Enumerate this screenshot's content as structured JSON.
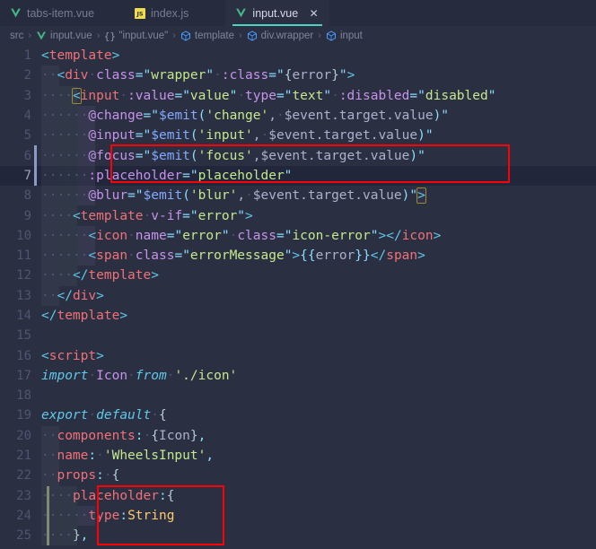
{
  "window": {
    "title": "input.vue"
  },
  "tabs": [
    {
      "label": "tabs-item.vue",
      "icon": "vue-file-icon",
      "active": false,
      "closable": false
    },
    {
      "label": "index.js",
      "icon": "js-file-icon",
      "active": false,
      "closable": false
    },
    {
      "label": "input.vue",
      "icon": "vue-file-icon",
      "active": true,
      "closable": true,
      "close_label": "✕"
    }
  ],
  "breadcrumb": {
    "separator": "›",
    "items": [
      {
        "label": "src",
        "icon": "none"
      },
      {
        "label": "input.vue",
        "icon": "vue-file-icon"
      },
      {
        "label": "\"input.vue\"",
        "icon": "braces-icon"
      },
      {
        "label": "template",
        "icon": "element-icon"
      },
      {
        "label": "div.wrapper",
        "icon": "element-icon"
      },
      {
        "label": "input",
        "icon": "element-icon"
      }
    ]
  },
  "colors": {
    "editor_background": "#2b2f42",
    "tabbar_background": "#262b3d",
    "active_tab_underline": "#4fd2c2",
    "annotation_red": "#fb0007",
    "git_added_marker": "#7d8f6b",
    "active_line_background": "#22263a",
    "tag_color": "#f07178",
    "attribute_color": "#c792ea",
    "string_color": "#c3e88d",
    "keyword_color": "#5fc8e8",
    "type_color": "#ffcb6b"
  },
  "editor": {
    "active_line": 7,
    "lines": [
      {
        "n": 1,
        "text": "<template>"
      },
      {
        "n": 2,
        "text": "  <div class=\"wrapper\" :class=\"{error}\">"
      },
      {
        "n": 3,
        "text": "    <input :value=\"value\" type=\"text\" :disabled=\"disabled\""
      },
      {
        "n": 4,
        "text": "      @change=\"$emit('change', $event.target.value)\""
      },
      {
        "n": 5,
        "text": "      @input=\"$emit('input', $event.target.value)\""
      },
      {
        "n": 6,
        "text": "      @focus=\"$emit('focus',$event.target.value)\""
      },
      {
        "n": 7,
        "text": "      :placeholder=\"placeholder\""
      },
      {
        "n": 8,
        "text": "      @blur=\"$emit('blur', $event.target.value)\">"
      },
      {
        "n": 9,
        "text": "    <template v-if=\"error\">"
      },
      {
        "n": 10,
        "text": "      <icon name=\"error\" class=\"icon-error\"></icon>"
      },
      {
        "n": 11,
        "text": "      <span class=\"errorMessage\">{{error}}</span>"
      },
      {
        "n": 12,
        "text": "    </template>"
      },
      {
        "n": 13,
        "text": "  </div>"
      },
      {
        "n": 14,
        "text": "</template>"
      },
      {
        "n": 15,
        "text": ""
      },
      {
        "n": 16,
        "text": "<script>"
      },
      {
        "n": 17,
        "text": "import Icon from './icon'"
      },
      {
        "n": 18,
        "text": ""
      },
      {
        "n": 19,
        "text": "export default {"
      },
      {
        "n": 20,
        "text": "  components: {Icon},"
      },
      {
        "n": 21,
        "text": "  name: 'WheelsInput',"
      },
      {
        "n": 22,
        "text": "  props: {"
      },
      {
        "n": 23,
        "text": "    placeholder:{"
      },
      {
        "n": 24,
        "text": "      type:String"
      },
      {
        "n": 25,
        "text": "    },"
      }
    ]
  },
  "annotations": [
    {
      "name": "focus-placeholder-highlight",
      "lines": [
        6,
        7
      ],
      "color": "#fb0007"
    },
    {
      "name": "placeholder-prop-highlight",
      "lines": [
        23,
        24,
        25
      ],
      "color": "#fb0007"
    }
  ]
}
